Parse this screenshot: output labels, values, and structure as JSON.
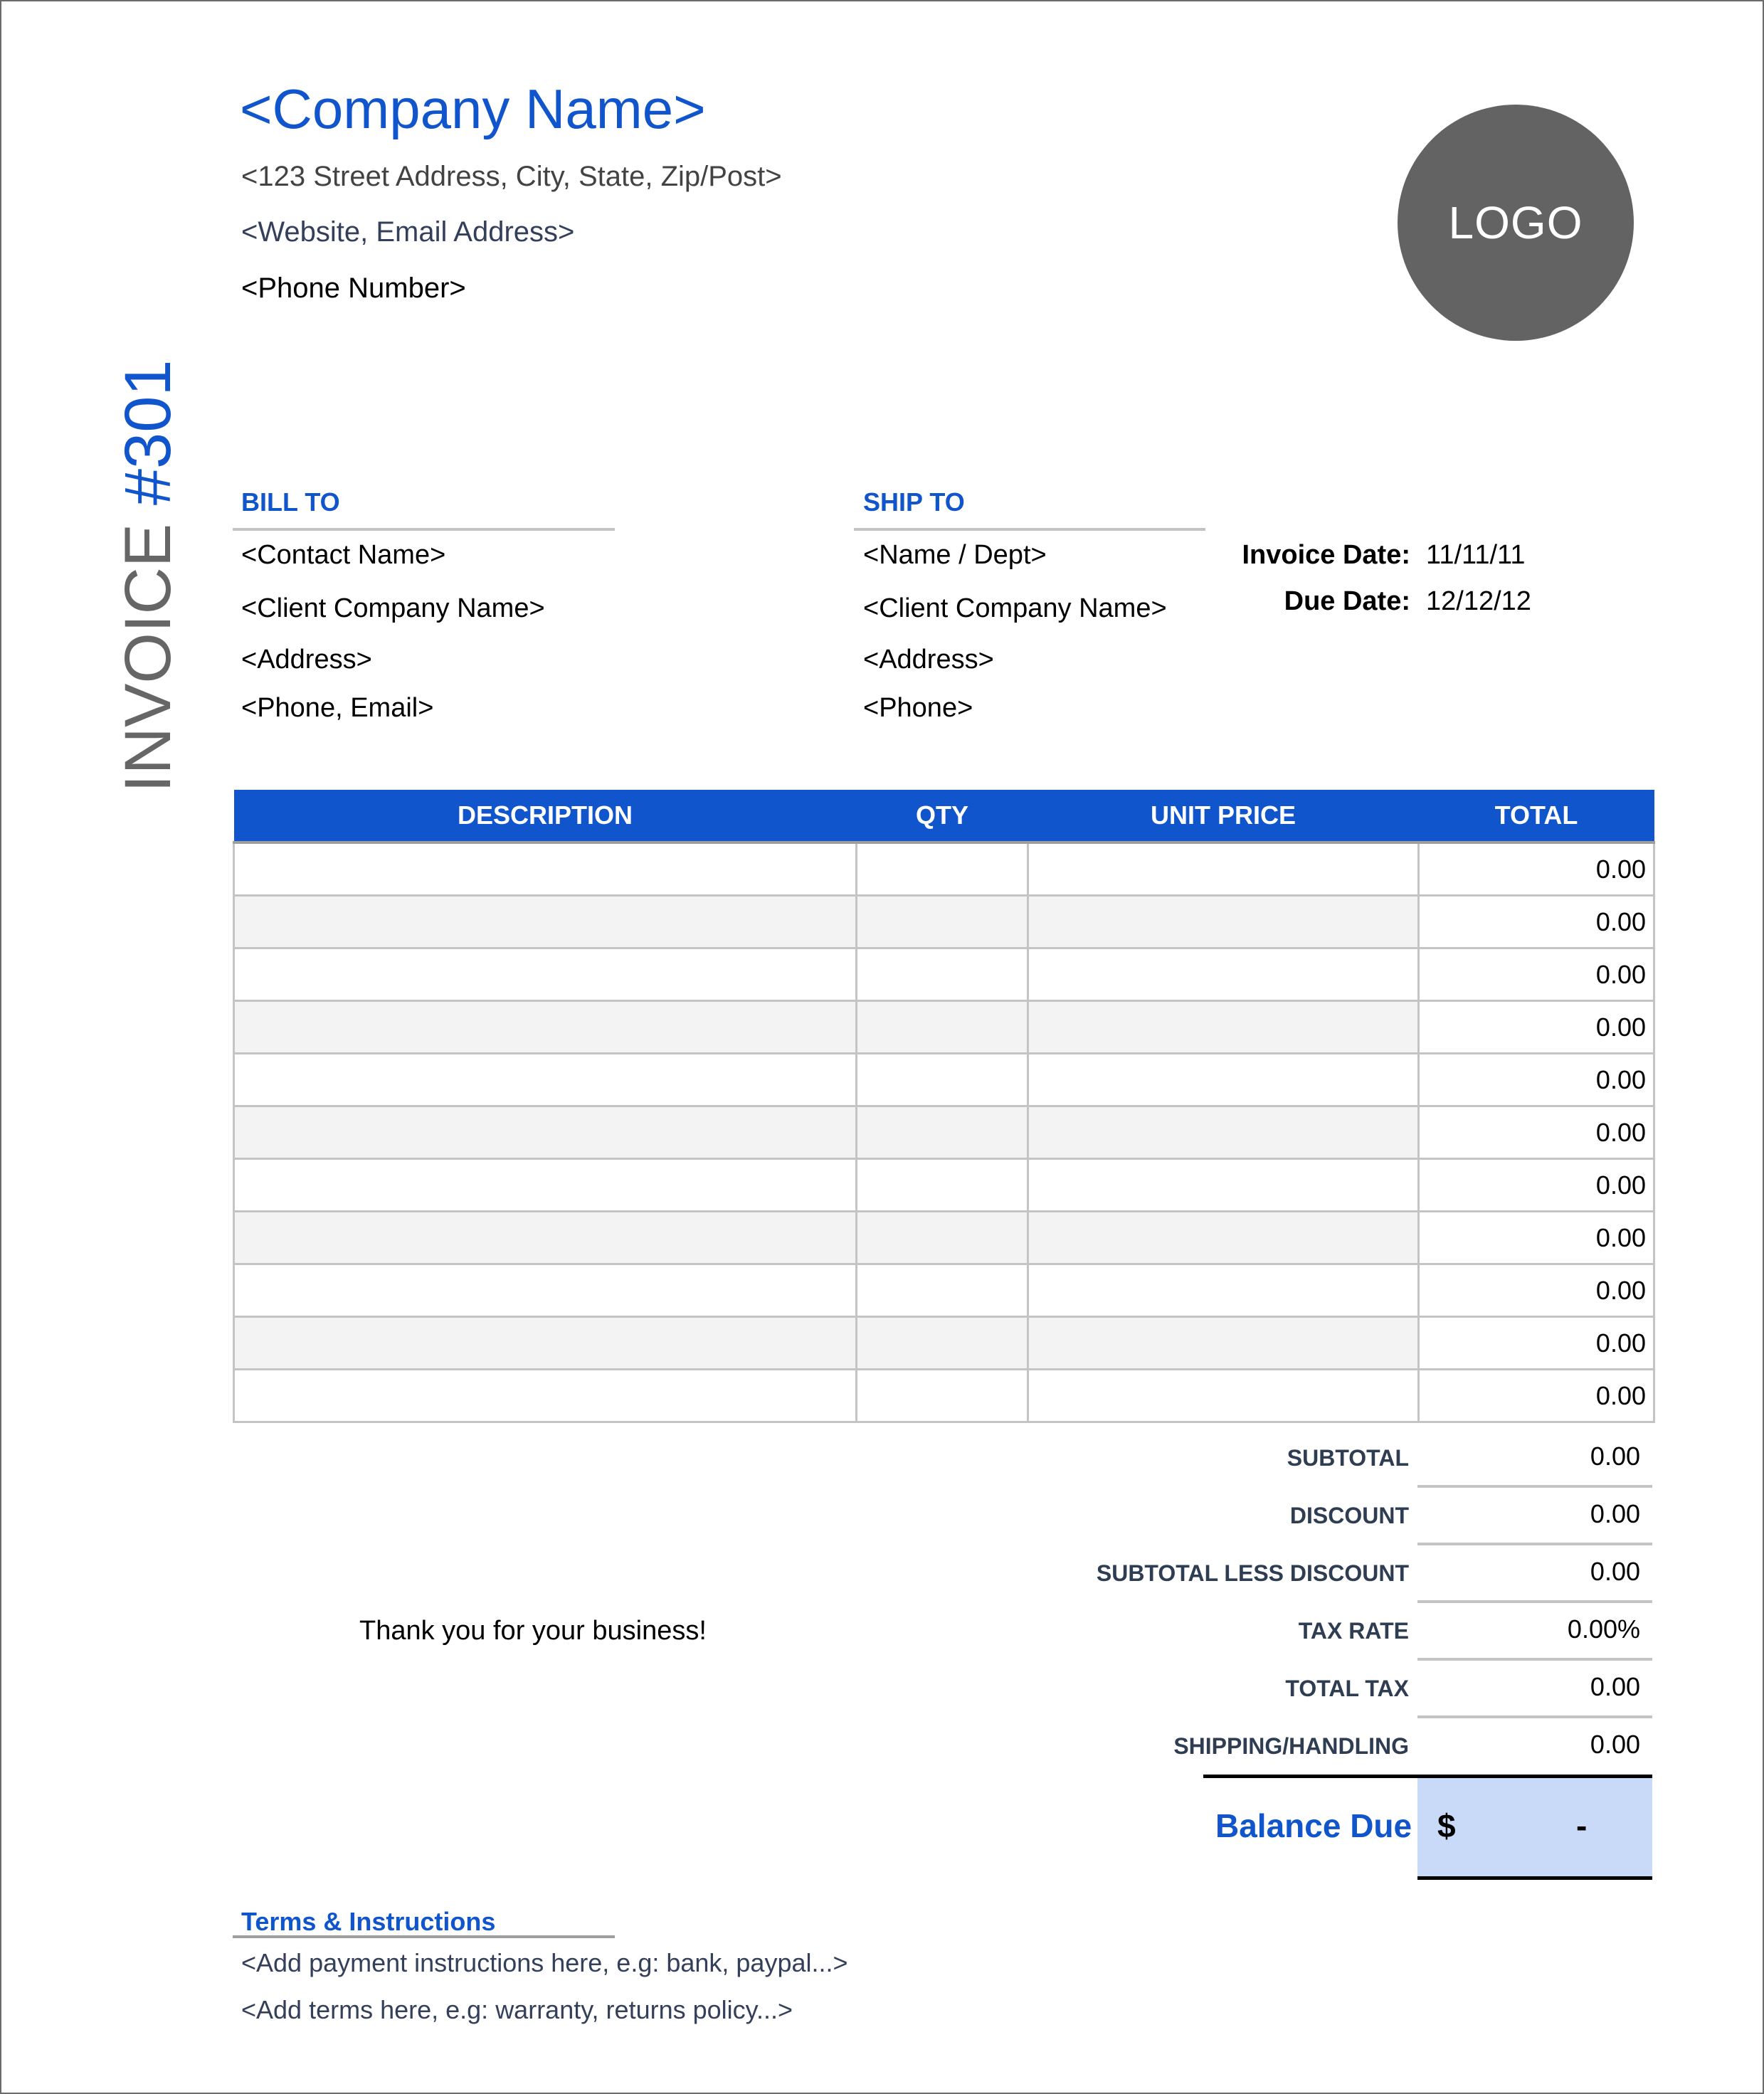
{
  "header": {
    "company_name": "<Company Name>",
    "street_address": "<123 Street Address, City, State, Zip/Post>",
    "website_email": "<Website, Email Address>",
    "phone": "<Phone Number>",
    "logo_text": "LOGO"
  },
  "invoice_title": {
    "word": "INVOICE",
    "number": "#301"
  },
  "bill_to": {
    "heading": "BILL TO",
    "lines": [
      "<Contact Name>",
      "<Client Company Name>",
      "<Address>",
      "<Phone, Email>"
    ]
  },
  "ship_to": {
    "heading": "SHIP TO",
    "lines": [
      "<Name / Dept>",
      "<Client Company Name>",
      "<Address>",
      "<Phone>"
    ]
  },
  "dates": {
    "invoice_date_label": "Invoice Date:",
    "invoice_date": "11/11/11",
    "due_date_label": "Due Date:",
    "due_date": "12/12/12"
  },
  "items_table": {
    "columns": [
      "DESCRIPTION",
      "QTY",
      "UNIT PRICE",
      "TOTAL"
    ],
    "rows": [
      {
        "description": "",
        "qty": "",
        "unit_price": "",
        "total": "0.00"
      },
      {
        "description": "",
        "qty": "",
        "unit_price": "",
        "total": "0.00"
      },
      {
        "description": "",
        "qty": "",
        "unit_price": "",
        "total": "0.00"
      },
      {
        "description": "",
        "qty": "",
        "unit_price": "",
        "total": "0.00"
      },
      {
        "description": "",
        "qty": "",
        "unit_price": "",
        "total": "0.00"
      },
      {
        "description": "",
        "qty": "",
        "unit_price": "",
        "total": "0.00"
      },
      {
        "description": "",
        "qty": "",
        "unit_price": "",
        "total": "0.00"
      },
      {
        "description": "",
        "qty": "",
        "unit_price": "",
        "total": "0.00"
      },
      {
        "description": "",
        "qty": "",
        "unit_price": "",
        "total": "0.00"
      },
      {
        "description": "",
        "qty": "",
        "unit_price": "",
        "total": "0.00"
      },
      {
        "description": "",
        "qty": "",
        "unit_price": "",
        "total": "0.00"
      }
    ]
  },
  "summary": [
    {
      "label": "SUBTOTAL",
      "value": "0.00"
    },
    {
      "label": "DISCOUNT",
      "value": "0.00"
    },
    {
      "label": "SUBTOTAL LESS DISCOUNT",
      "value": "0.00"
    },
    {
      "label": "TAX RATE",
      "value": "0.00%"
    },
    {
      "label": "TOTAL TAX",
      "value": "0.00"
    },
    {
      "label": "SHIPPING/HANDLING",
      "value": "0.00"
    }
  ],
  "balance_due": {
    "label": "Balance Due",
    "currency": "$",
    "value": "-"
  },
  "thank_you": "Thank you for your business!",
  "terms": {
    "heading": "Terms & Instructions",
    "lines": [
      "<Add payment instructions here, e.g: bank, paypal...>",
      "<Add terms here, e.g: warranty, returns policy...>"
    ]
  },
  "colors": {
    "accent_blue": "#1155cc",
    "balance_fill": "#c9daf8",
    "logo_gray": "#636363",
    "row_shade": "#f3f3f3"
  }
}
